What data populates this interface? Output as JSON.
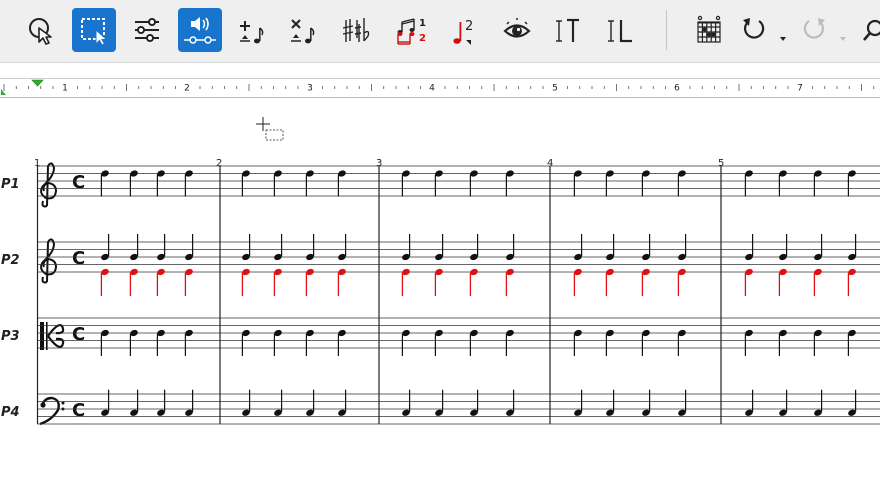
{
  "toolbar": {
    "tools": [
      {
        "name": "pointer-tool",
        "icon": "pointer-icon",
        "active": false
      },
      {
        "name": "select-region-tool",
        "icon": "select-region-icon",
        "active": true
      },
      {
        "name": "mixer-tool",
        "icon": "sliders-icon",
        "active": false
      },
      {
        "name": "playback-tool",
        "icon": "speaker-icon",
        "active": true
      },
      {
        "name": "insert-note-tool",
        "icon": "insert-note-icon",
        "active": false
      },
      {
        "name": "delete-note-tool",
        "icon": "delete-note-icon",
        "active": false
      },
      {
        "name": "accidentals-tool",
        "icon": "accidentals-icon",
        "active": false
      },
      {
        "name": "voices-tool",
        "icon": "voices-icon",
        "active": false
      },
      {
        "name": "note-superscript-tool",
        "icon": "note-superscript-icon",
        "active": false
      },
      {
        "name": "view-tool",
        "icon": "eye-icon",
        "active": false
      },
      {
        "name": "text-tool",
        "icon": "text-cursor-icon",
        "active": false
      },
      {
        "name": "lyrics-tool",
        "icon": "lyrics-icon",
        "active": false
      },
      {
        "name": "chord-diagram-tool",
        "icon": "chord-grid-icon",
        "active": false
      },
      {
        "name": "undo-button",
        "icon": "undo-icon",
        "active": false
      },
      {
        "name": "redo-button",
        "icon": "redo-icon",
        "active": false
      },
      {
        "name": "search-button",
        "icon": "search-icon",
        "active": false
      }
    ],
    "voices_badge_1": "1",
    "voices_badge_2": "2",
    "superscript_label": "2"
  },
  "ruler": {
    "labels": [
      "1",
      "2",
      "3",
      "4",
      "5",
      "6",
      "7"
    ]
  },
  "score": {
    "measure_numbers": [
      "1",
      "2",
      "3",
      "4",
      "5"
    ],
    "parts": [
      {
        "label": "P1",
        "clef": "treble"
      },
      {
        "label": "P2",
        "clef": "treble"
      },
      {
        "label": "P3",
        "clef": "alto"
      },
      {
        "label": "P4",
        "clef": "bass"
      }
    ],
    "time_signature": "C",
    "highlight_color": "#e01010",
    "accent_color": "#1874cd"
  }
}
